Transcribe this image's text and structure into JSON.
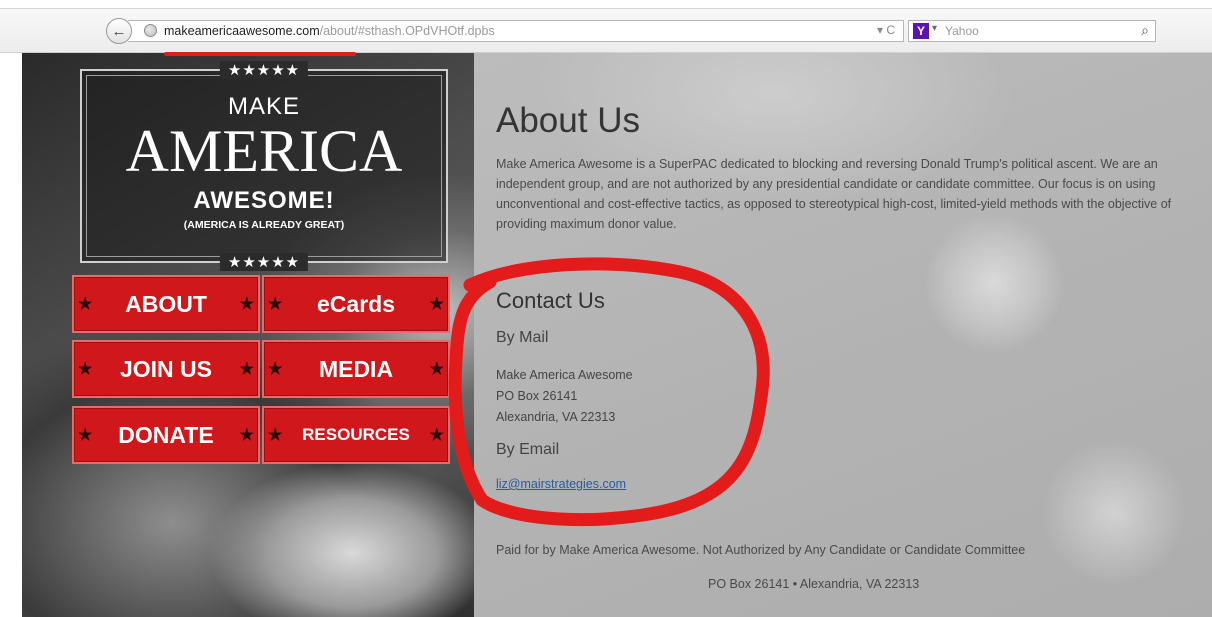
{
  "browser": {
    "url_domain": "makeamericaawesome.com",
    "url_path": "/about/#sthash.OPdVHOtf.dpbs",
    "reload_label": "▾ C",
    "search_engine": "Yahoo",
    "search_logo_letter": "Y",
    "search_dropdown": "▾",
    "icons": [
      "back-arrow-icon",
      "globe-icon",
      "reload-icon",
      "search-icon"
    ]
  },
  "logo": {
    "stars_top": "★★★★★",
    "make": "MAKE",
    "america": "AMERICA",
    "awesome": "AWESOME!",
    "subtitle": "(AMERICA IS ALREADY GREAT)",
    "stars_bottom": "★★★★★"
  },
  "nav": {
    "about": "ABOUT",
    "ecards": "eCards",
    "join": "JOIN US",
    "media": "MEDIA",
    "donate": "DONATE",
    "resources": "RESOURCES",
    "star": "★"
  },
  "about": {
    "title": "About Us",
    "body": "Make America Awesome is a SuperPAC dedicated to blocking and reversing Donald Trump's political ascent. We are an independent group, and are not authorized by any presidential candidate or candidate committee. Our focus is on using unconventional and cost-effective tactics, as opposed to stereotypical high-cost, limited-yield methods with the objective of providing maximum donor value."
  },
  "contact": {
    "title": "Contact Us",
    "by_mail": "By Mail",
    "address_line1": "Make America Awesome",
    "address_line2": "PO Box 26141",
    "address_line3": "Alexandria, VA 22313",
    "by_email": "By Email",
    "email": "liz@mairstrategies.com"
  },
  "footer": {
    "paid_for": "Paid for by Make America Awesome. Not Authorized by Any Candidate or Candidate Committee",
    "address": "PO Box 26141 • Alexandria, VA 22313"
  },
  "colors": {
    "nav_red": "#d0171b",
    "annotation_red": "#e31b1b",
    "link_blue": "#2b5a9e"
  }
}
